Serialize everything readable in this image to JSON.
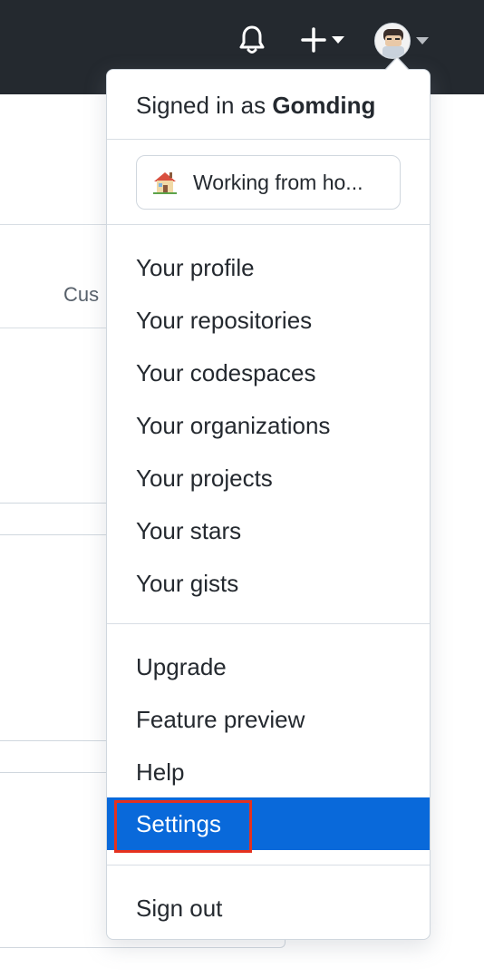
{
  "colors": {
    "topbar": "#24292f",
    "active_item": "#0969da",
    "highlight_outline": "#e5311e"
  },
  "header": {
    "icons": [
      "bell-icon",
      "plus-icon",
      "caret-down-icon",
      "avatar",
      "caret-down-icon"
    ]
  },
  "background": {
    "partial_text": "Cus"
  },
  "dropdown": {
    "signed_in_prefix": "Signed in as ",
    "username": "Gomding",
    "status": {
      "emoji": "house-icon",
      "text": "Working from ho..."
    },
    "section1": [
      {
        "label": "Your profile"
      },
      {
        "label": "Your repositories"
      },
      {
        "label": "Your codespaces"
      },
      {
        "label": "Your organizations"
      },
      {
        "label": "Your projects"
      },
      {
        "label": "Your stars"
      },
      {
        "label": "Your gists"
      }
    ],
    "section2": [
      {
        "label": "Upgrade"
      },
      {
        "label": "Feature preview"
      },
      {
        "label": "Help"
      },
      {
        "label": "Settings",
        "active": true
      }
    ],
    "sign_out": "Sign out"
  }
}
